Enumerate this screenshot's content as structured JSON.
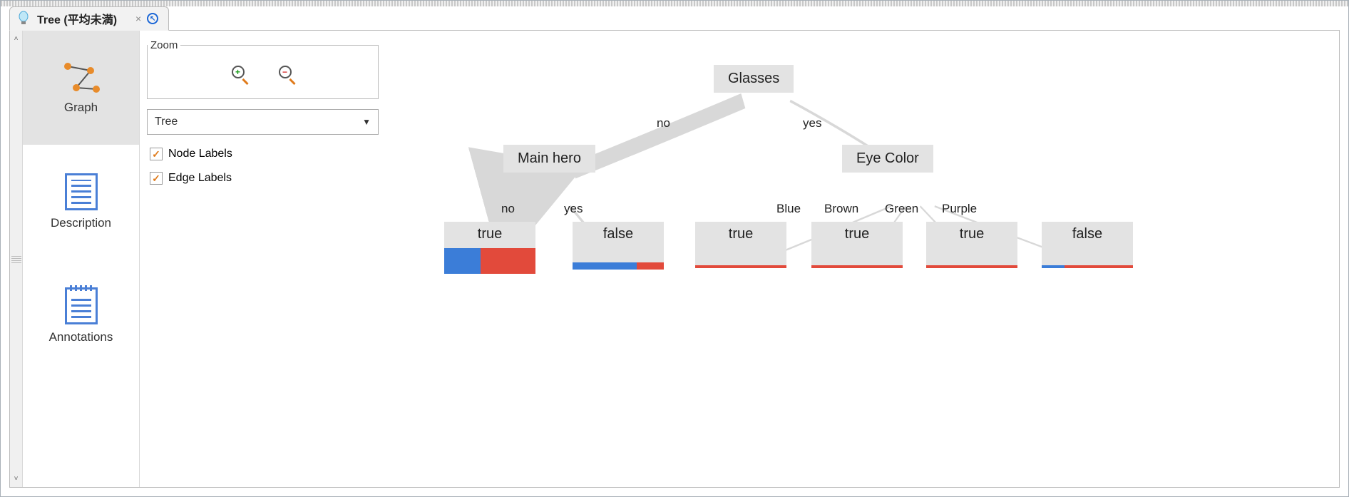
{
  "tab": {
    "title": "Tree (平均未満)",
    "close": "×",
    "refresh": "↖"
  },
  "sidebar": {
    "items": [
      {
        "label": "Graph"
      },
      {
        "label": "Description"
      },
      {
        "label": "Annotations"
      }
    ]
  },
  "controls": {
    "zoom_legend": "Zoom",
    "dropdown_value": "Tree",
    "checkbox1": "Node Labels",
    "checkbox2": "Edge Labels"
  },
  "tree": {
    "root": "Glasses",
    "root_edges": {
      "left": "no",
      "right": "yes"
    },
    "left_node": "Main hero",
    "left_edges": {
      "left": "no",
      "right": "yes"
    },
    "right_node": "Eye Color",
    "right_edges": [
      "Blue",
      "Brown",
      "Green",
      "Purple"
    ],
    "leaves": [
      {
        "label": "true",
        "blue": 40,
        "red": 60,
        "size": "tall"
      },
      {
        "label": "false",
        "blue": 70,
        "red": 30,
        "size": "med"
      },
      {
        "label": "true",
        "blue": 0,
        "red": 100,
        "size": "thin"
      },
      {
        "label": "true",
        "blue": 0,
        "red": 100,
        "size": "thin"
      },
      {
        "label": "true",
        "blue": 0,
        "red": 100,
        "size": "thin"
      },
      {
        "label": "false",
        "blue": 25,
        "red": 75,
        "size": "thin"
      }
    ]
  }
}
